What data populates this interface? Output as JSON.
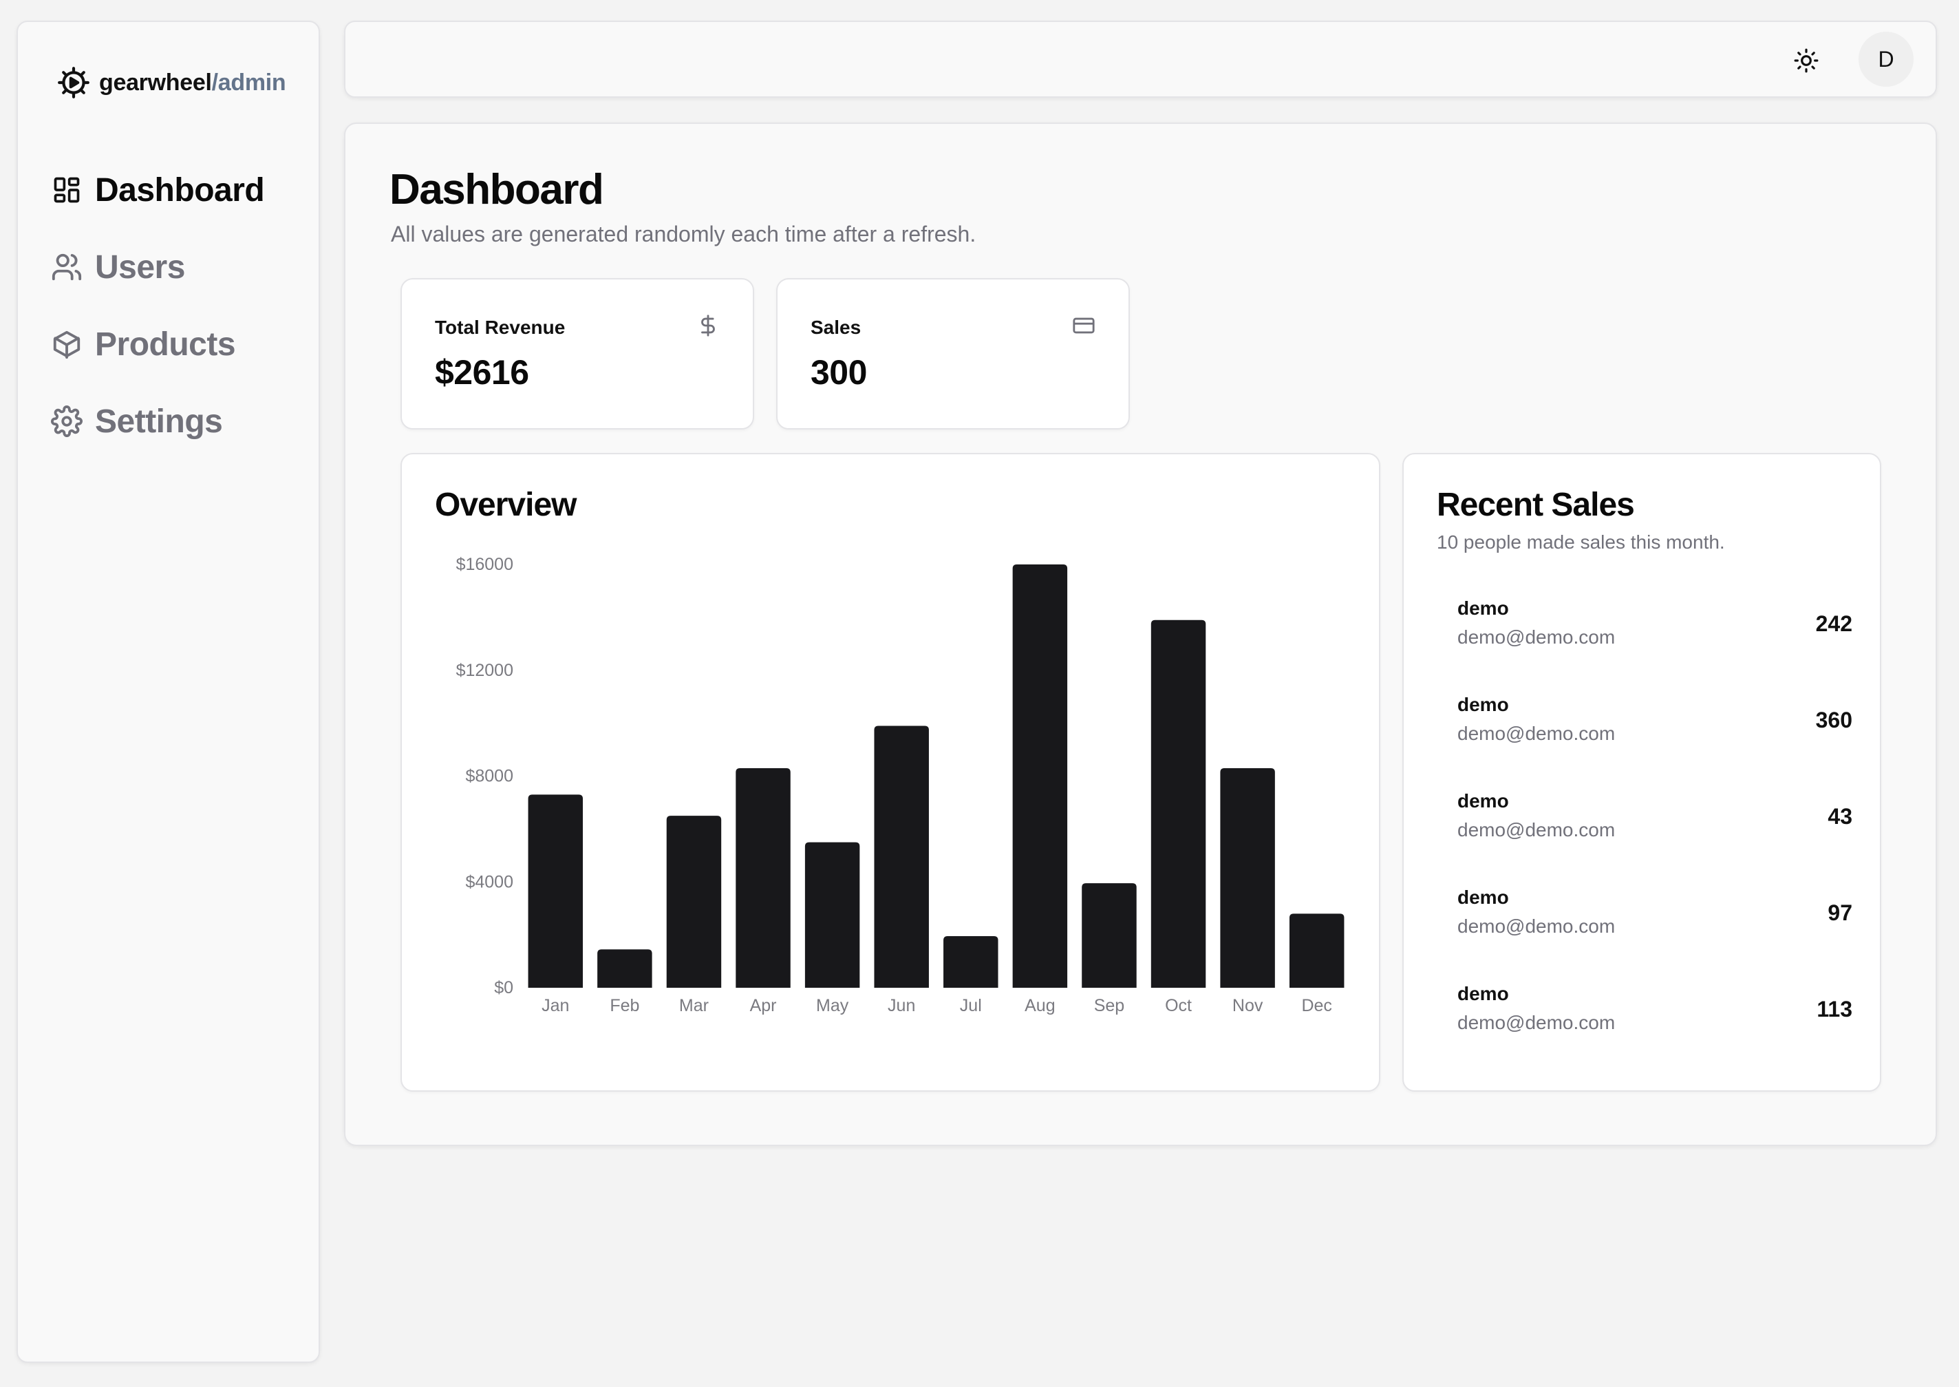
{
  "brand": {
    "name": "gearwheel",
    "suffix": "/admin",
    "icon": "gearwheel-icon"
  },
  "sidebar": {
    "items": [
      {
        "label": "Dashboard",
        "icon": "dashboard-icon",
        "active": true
      },
      {
        "label": "Users",
        "icon": "users-icon",
        "active": false
      },
      {
        "label": "Products",
        "icon": "box-icon",
        "active": false
      },
      {
        "label": "Settings",
        "icon": "gear-icon",
        "active": false
      }
    ]
  },
  "header": {
    "theme_icon": "sun-icon",
    "avatar_initial": "D"
  },
  "main": {
    "title": "Dashboard",
    "subtitle": "All values are generated randomly each time after a refresh."
  },
  "stats": [
    {
      "label": "Total Revenue",
      "value": "$2616",
      "icon": "dollar-icon"
    },
    {
      "label": "Sales",
      "value": "300",
      "icon": "credit-card-icon"
    }
  ],
  "overview": {
    "title": "Overview"
  },
  "chart_data": {
    "type": "bar",
    "title": "Overview",
    "categories": [
      "Jan",
      "Feb",
      "Mar",
      "Apr",
      "May",
      "Jun",
      "Jul",
      "Aug",
      "Sep",
      "Oct",
      "Nov",
      "Dec"
    ],
    "values": [
      7300,
      1450,
      6500,
      8300,
      5500,
      9900,
      1950,
      16000,
      3950,
      13900,
      8300,
      2800
    ],
    "ylim": [
      0,
      16000
    ],
    "yticks": [
      0,
      4000,
      8000,
      12000,
      16000
    ],
    "ytick_labels": [
      "$0",
      "$4000",
      "$8000",
      "$12000",
      "$16000"
    ],
    "xlabel": "",
    "ylabel": "",
    "grid": false,
    "bar_color": "#18181b"
  },
  "recent_sales": {
    "title": "Recent Sales",
    "subtitle": "10 people made sales this month.",
    "items": [
      {
        "name": "demo",
        "email": "demo@demo.com",
        "amount": "242"
      },
      {
        "name": "demo",
        "email": "demo@demo.com",
        "amount": "360"
      },
      {
        "name": "demo",
        "email": "demo@demo.com",
        "amount": "43"
      },
      {
        "name": "demo",
        "email": "demo@demo.com",
        "amount": "97"
      },
      {
        "name": "demo",
        "email": "demo@demo.com",
        "amount": "113"
      }
    ]
  }
}
